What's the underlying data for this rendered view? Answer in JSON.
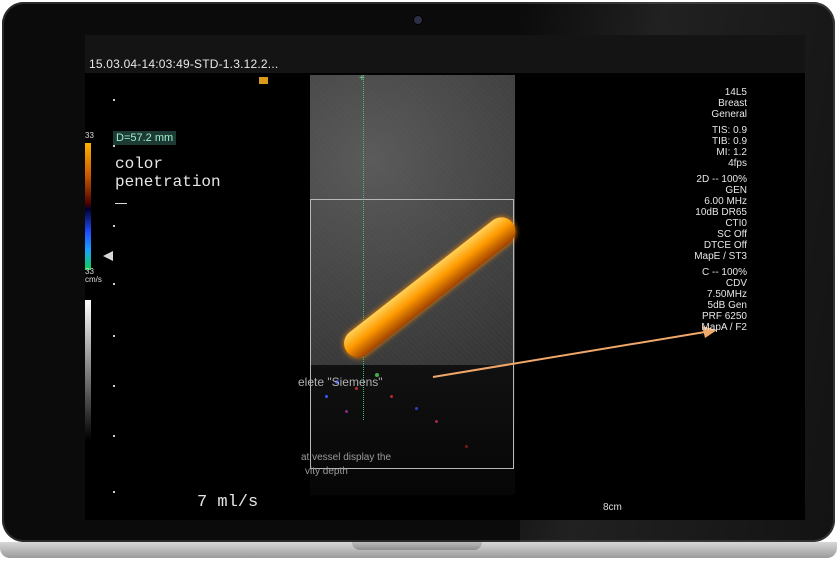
{
  "header": {
    "session_id": "15.03.04-14:03:49-STD-1.3.12.2..."
  },
  "left_panel": {
    "scale_top": "33",
    "scale_bottom": "33",
    "scale_unit": "cm/s",
    "measurement": "D=57.2 mm",
    "overlay_line1": "color",
    "overlay_line2": "penetration",
    "flow_rate": "7 ml/s"
  },
  "settings": {
    "probe": "14L5",
    "preset": "Breast",
    "mode": "General",
    "tis": "TIS: 0.9",
    "tib": "TIB: 0.9",
    "mi": "MI: 1.2",
    "fps": "4fps",
    "b_mode": "2D -- 100%",
    "gen": "GEN",
    "b_freq": "6.00 MHz",
    "dr": "10dB DR65",
    "cti": "CTI0",
    "sc": "SC Off",
    "dtce": "DTCE Off",
    "map_e": "MapE / ST3",
    "c_mode": "C -- 100%",
    "cdv": "CDV",
    "c_freq": "7.50MHz",
    "c_gain": "5dB Gen",
    "prf": "PRF 6250",
    "map_a": "MapA / F2"
  },
  "footer": {
    "depth": "8cm"
  },
  "annotations": {
    "text1": "elete \"Siemens\"",
    "text2": "at vessel display the",
    "text3": "vity depth"
  },
  "colors": {
    "accent_orange": "#ff9b00",
    "measurement_bg": "#1e3a34",
    "measurement_text": "#9cf0cf"
  }
}
